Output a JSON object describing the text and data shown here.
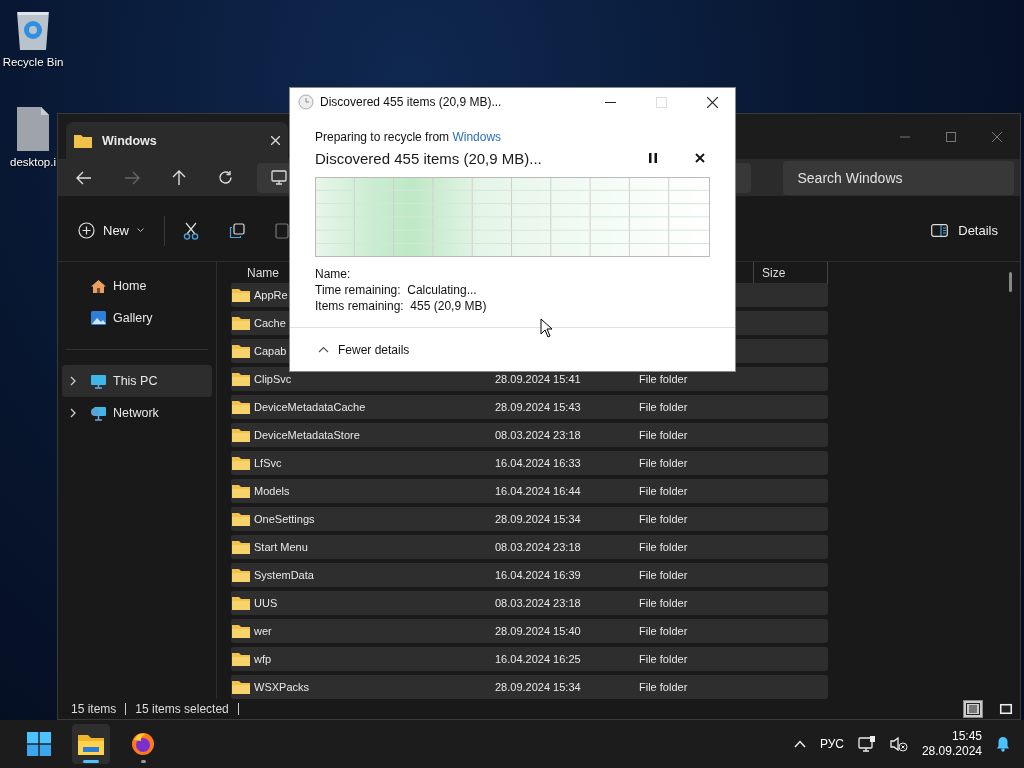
{
  "desktop_icons": [
    {
      "label": "Recycle Bin",
      "kind": "recycle"
    },
    {
      "label": "desktop.i",
      "kind": "file"
    }
  ],
  "explorer": {
    "tab": "Windows",
    "search": {
      "placeholder": "Search Windows"
    },
    "toolbar": {
      "new": "New",
      "details": "Details"
    },
    "sidebar": [
      {
        "label": "Home",
        "kind": "home",
        "selected": false,
        "expandable": false
      },
      {
        "label": "Gallery",
        "kind": "gallery",
        "selected": false,
        "expandable": false
      },
      {
        "label": "This PC",
        "kind": "pc",
        "selected": true,
        "expandable": true
      },
      {
        "label": "Network",
        "kind": "network",
        "selected": false,
        "expandable": true
      }
    ],
    "columns": [
      "Name",
      "Size"
    ],
    "rows": [
      {
        "name": "AppRe",
        "selected": true
      },
      {
        "name": "Cache",
        "selected": true
      },
      {
        "name": "Capab",
        "selected": true
      },
      {
        "name": "ClipSvc",
        "date": "28.09.2024 15:41",
        "type": "File folder",
        "selected": true
      },
      {
        "name": "DeviceMetadataCache",
        "date": "28.09.2024 15:43",
        "type": "File folder",
        "selected": true
      },
      {
        "name": "DeviceMetadataStore",
        "date": "08.03.2024 23:18",
        "type": "File folder",
        "selected": true
      },
      {
        "name": "LfSvc",
        "date": "16.04.2024 16:33",
        "type": "File folder",
        "selected": true
      },
      {
        "name": "Models",
        "date": "16.04.2024 16:44",
        "type": "File folder",
        "selected": true
      },
      {
        "name": "OneSettings",
        "date": "28.09.2024 15:34",
        "type": "File folder",
        "selected": true
      },
      {
        "name": "Start Menu",
        "date": "08.03.2024 23:18",
        "type": "File folder",
        "selected": true
      },
      {
        "name": "SystemData",
        "date": "16.04.2024 16:39",
        "type": "File folder",
        "selected": true
      },
      {
        "name": "UUS",
        "date": "08.03.2024 23:18",
        "type": "File folder",
        "selected": true
      },
      {
        "name": "wer",
        "date": "28.09.2024 15:40",
        "type": "File folder",
        "selected": true
      },
      {
        "name": "wfp",
        "date": "16.04.2024 16:25",
        "type": "File folder",
        "selected": true
      },
      {
        "name": "WSXPacks",
        "date": "28.09.2024 15:34",
        "type": "File folder",
        "selected": true
      }
    ],
    "status": {
      "count": "15 items",
      "selection": "15 items selected"
    },
    "view_buttons": [
      {
        "kind": "details",
        "selected": true
      },
      {
        "kind": "tiles",
        "selected": false
      }
    ]
  },
  "dialog": {
    "title": "Discovered 455 items (20,9 MB)...",
    "source_prefix": "Preparing to recycle from",
    "source_link": "Windows",
    "heading": "Discovered 455 items (20,9 MB)...",
    "details": [
      {
        "label": "Name:"
      },
      {
        "label": "Time remaining:",
        "value": "Calculating..."
      },
      {
        "label": "Items remaining:",
        "value": "455 (20,9 MB)"
      }
    ],
    "toggle": "Fewer details"
  },
  "taskbar": {
    "apps": [
      {
        "kind": "start",
        "active": false
      },
      {
        "kind": "explorer",
        "active": true
      },
      {
        "kind": "firefox",
        "active": false
      }
    ],
    "tray": {
      "language": "РУС",
      "time": "15:45",
      "date": "28.09.2024"
    }
  }
}
